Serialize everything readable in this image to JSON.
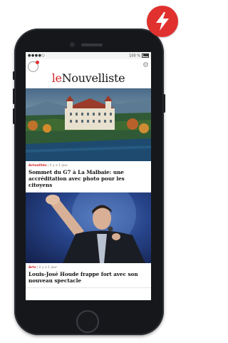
{
  "badge": {
    "icon": "lightning-bolt-icon",
    "color": "#e0312f"
  },
  "status_bar": {
    "left": "●●●●○",
    "right": "100 %"
  },
  "app": {
    "brand_prefix": "le",
    "brand_name": "Nouvelliste",
    "brand_color": "#d6262b",
    "logo_icon": "le-nouvelliste-logo-icon",
    "settings_icon": "gear-icon"
  },
  "articles": [
    {
      "category": "Actualités",
      "time": " | Il y a 1 jour",
      "headline": "Sommet du G7 à La Malbaie: une accréditation avec photo pour les citoyens",
      "image": "chateau-hotel-landscape-photo"
    },
    {
      "category": "Arts",
      "time": " | Il y a 1 jour",
      "headline": "Louis-José Houde frappe fort avec son nouveau spectacle",
      "image": "comedian-on-stage-photo"
    }
  ]
}
